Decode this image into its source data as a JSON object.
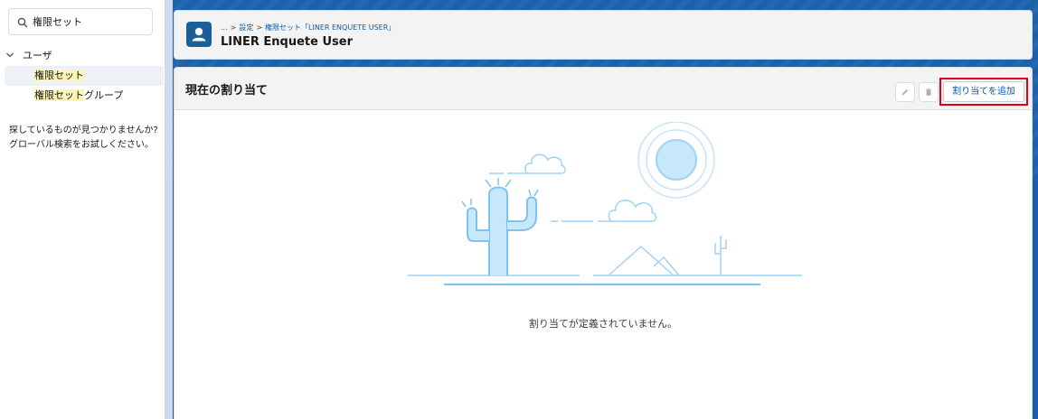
{
  "sidebar": {
    "search": {
      "value": "権限セット",
      "icon": "search-icon"
    },
    "tree": {
      "parent_label": "ユーザ",
      "items": [
        {
          "highlight": "権限セット",
          "rest": "",
          "selected": true
        },
        {
          "highlight": "権限セット",
          "rest": "グループ",
          "selected": false
        }
      ]
    },
    "help_line1": "探しているものが見つかりませんか?",
    "help_line2": "グローバル検索をお試しください。"
  },
  "header": {
    "icon": "user-icon",
    "breadcrumb": {
      "ellipsis": "...",
      "settings": "設定",
      "perm_set": "権限セット「LINER ENQUETE USER」"
    },
    "title": "LINER Enquete User"
  },
  "assignments": {
    "title": "現在の割り当て",
    "edit_icon": "pencil-icon",
    "delete_icon": "trash-icon",
    "add_label": "割り当てを追加",
    "empty_message": "割り当てが定義されていません。"
  },
  "colors": {
    "brand": "#1b5f98",
    "link": "#0b5cab",
    "highlight": "#fdf6b8",
    "outline": "#e0001b",
    "illustration": "#9fd3f5"
  }
}
